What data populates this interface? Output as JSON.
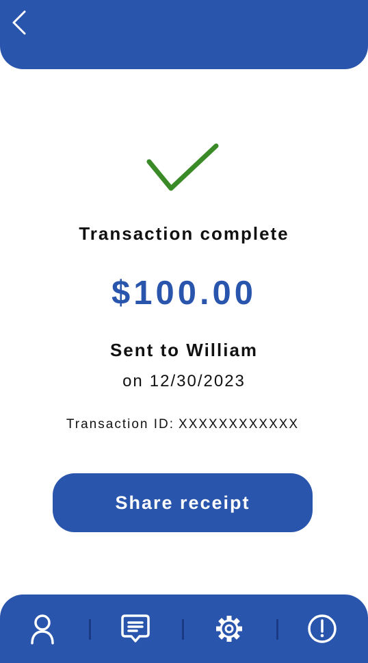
{
  "header": {
    "back_icon": "chevron-left-icon"
  },
  "status": {
    "icon": "checkmark-icon",
    "icon_color": "#3a8b28",
    "title": "Transaction complete"
  },
  "transaction": {
    "amount": "$100.00",
    "recipient_line": "Sent to William",
    "date_prefix": "on",
    "date": "12/30/2023",
    "id_label": "Transaction ID:",
    "id_value": "XXXXXXXXXXXX"
  },
  "actions": {
    "share_label": "Share receipt"
  },
  "bottom_nav": {
    "items": [
      {
        "icon": "profile-icon"
      },
      {
        "icon": "messages-icon"
      },
      {
        "icon": "settings-icon"
      },
      {
        "icon": "alert-icon"
      }
    ]
  },
  "colors": {
    "primary": "#2a55ad",
    "success": "#3a8b28",
    "text": "#111111",
    "background": "#ffffff"
  }
}
